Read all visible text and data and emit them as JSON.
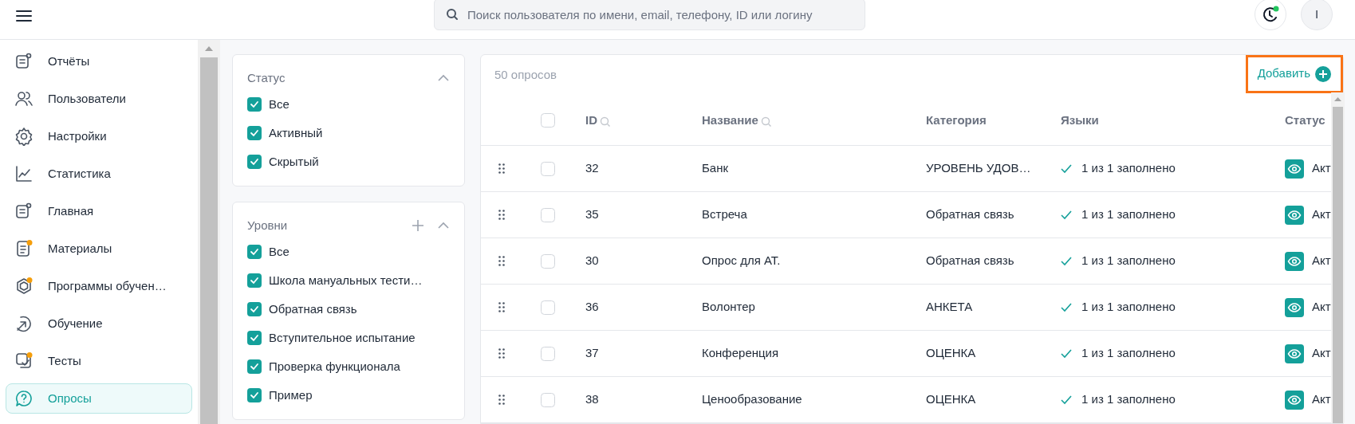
{
  "top_bar": {
    "search": {
      "placeholder": "Поиск пользователя по имени, email, телефону, ID или логину"
    },
    "avatar": {
      "initial": "I"
    }
  },
  "sidebar": {
    "items": [
      {
        "label": "Отчёты",
        "selected": false,
        "badge": false
      },
      {
        "label": "Пользователи",
        "selected": false,
        "badge": false
      },
      {
        "label": "Настройки",
        "selected": false,
        "badge": false
      },
      {
        "label": "Статистика",
        "selected": false,
        "badge": false
      },
      {
        "label": "Главная",
        "selected": false,
        "badge": false
      },
      {
        "label": "Материалы",
        "selected": false,
        "badge": true
      },
      {
        "label": "Программы обучен…",
        "selected": false,
        "badge": true
      },
      {
        "label": "Обучение",
        "selected": false,
        "badge": false
      },
      {
        "label": "Тесты",
        "selected": false,
        "badge": true
      },
      {
        "label": "Опросы",
        "selected": true,
        "badge": false
      }
    ]
  },
  "filters": [
    {
      "title": "Статус",
      "addable": false,
      "options": [
        {
          "label": "Все",
          "checked": true
        },
        {
          "label": "Активный",
          "checked": true
        },
        {
          "label": "Скрытый",
          "checked": true
        }
      ]
    },
    {
      "title": "Уровни",
      "addable": true,
      "options": [
        {
          "label": "Все",
          "checked": true
        },
        {
          "label": "Школа мануальных тести…",
          "checked": true
        },
        {
          "label": "Обратная связь",
          "checked": true
        },
        {
          "label": "Вступительное испытание",
          "checked": true
        },
        {
          "label": "Проверка функционала",
          "checked": true
        },
        {
          "label": "Пример",
          "checked": true
        }
      ]
    }
  ],
  "table": {
    "count": "50 опросов",
    "add_button": {
      "label": "Добавить",
      "highlighted": true
    },
    "all_checked": false,
    "columns": [
      {
        "label": "ID",
        "searchable": true
      },
      {
        "label": "Название",
        "searchable": true
      },
      {
        "label": "Категория",
        "searchable": false
      },
      {
        "label": "Языки",
        "searchable": false
      },
      {
        "label": "Статус",
        "searchable": false
      }
    ],
    "rows": [
      {
        "id": "32",
        "name": "Банк",
        "category": "УРОВЕНЬ УДОВ…",
        "languages": "1 из 1 заполнено",
        "status": "Акт",
        "visible": true,
        "checked": false
      },
      {
        "id": "35",
        "name": "Встреча",
        "category": "Обратная связь",
        "languages": "1 из 1 заполнено",
        "status": "Акт",
        "visible": true,
        "checked": false
      },
      {
        "id": "30",
        "name": "Опрос для АТ.",
        "category": "Обратная связь",
        "languages": "1 из 1 заполнено",
        "status": "Акт",
        "visible": true,
        "checked": false
      },
      {
        "id": "36",
        "name": "Волонтер",
        "category": "АНКЕТА",
        "languages": "1 из 1 заполнено",
        "status": "Акт",
        "visible": true,
        "checked": false
      },
      {
        "id": "37",
        "name": "Конференция",
        "category": "ОЦЕНКА",
        "languages": "1 из 1 заполнено",
        "status": "Акт",
        "visible": true,
        "checked": false
      },
      {
        "id": "38",
        "name": "Ценообразование",
        "category": "ОЦЕНКА",
        "languages": "1 из 1 заполнено",
        "status": "Акт",
        "visible": true,
        "checked": false
      }
    ]
  }
}
